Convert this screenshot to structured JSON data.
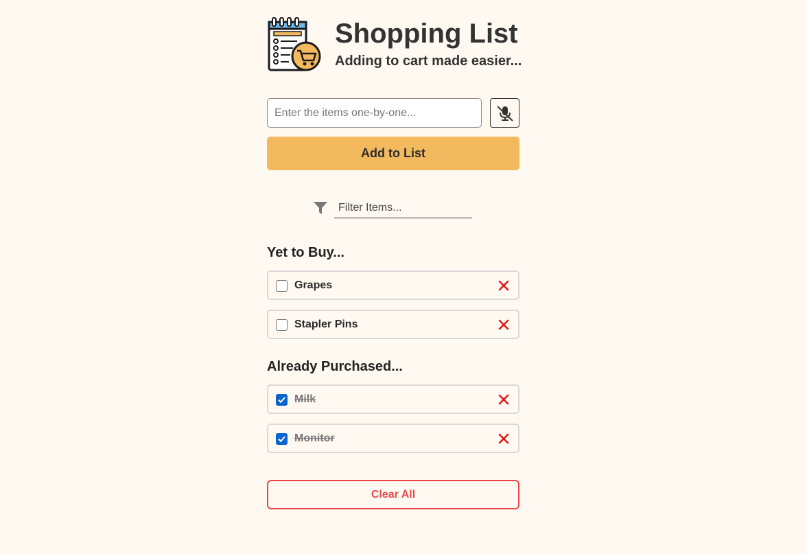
{
  "header": {
    "title": "Shopping List",
    "subtitle": "Adding to cart made easier...",
    "logo_icon": "notepad-cart-icon"
  },
  "entry": {
    "placeholder": "Enter the items one-by-one...",
    "value": "",
    "mic_icon": "mic-off-icon",
    "add_label": "Add to List"
  },
  "filter": {
    "icon": "funnel-icon",
    "placeholder": "Filter Items...",
    "value": ""
  },
  "sections": {
    "pending_title": "Yet to Buy...",
    "purchased_title": "Already Purchased..."
  },
  "pending_items": [
    {
      "label": "Grapes",
      "checked": false
    },
    {
      "label": "Stapler Pins",
      "checked": false
    }
  ],
  "purchased_items": [
    {
      "label": "Milk",
      "checked": true
    },
    {
      "label": "Monitor",
      "checked": true
    }
  ],
  "actions": {
    "clear_label": "Clear All",
    "delete_icon": "close-icon"
  },
  "colors": {
    "background": "#fff9f2",
    "accent": "#f3b95f",
    "danger": "#e84a4a",
    "checkbox": "#0b63ce"
  }
}
